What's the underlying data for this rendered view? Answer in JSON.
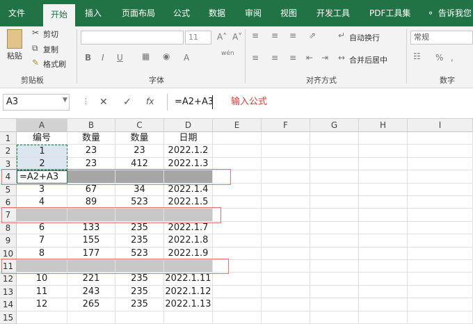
{
  "tabs": [
    "文件",
    "开始",
    "插入",
    "页面布局",
    "公式",
    "数据",
    "审阅",
    "视图",
    "开发工具",
    "PDF工具集",
    "告诉我您"
  ],
  "ribbon": {
    "paste": "粘贴",
    "cut": "剪切",
    "copy": "复制",
    "format_painter": "格式刷",
    "clipboard": "剪贴板",
    "font_size": "11",
    "font_group": "字体",
    "wrap": "自动换行",
    "merge": "合并后居中",
    "align_group": "对齐方式",
    "number_format": "常规",
    "number_group": "数字",
    "bold": "B",
    "italic": "I",
    "underline": "U",
    "font_a": "A",
    "wen": "wén"
  },
  "formula_bar": {
    "name_box": "A3",
    "formula": "=A2+A3",
    "annotation": "输入公式",
    "cancel": "✕",
    "enter": "✓",
    "fx": "fx"
  },
  "columns": [
    "A",
    "B",
    "C",
    "D",
    "E",
    "F",
    "G",
    "H",
    "I"
  ],
  "rows": [
    {
      "n": "1",
      "cells": [
        "编号",
        "数量",
        "数量",
        "日期"
      ]
    },
    {
      "n": "2",
      "cells": [
        "1",
        "23",
        "23",
        "2022.1.2"
      ]
    },
    {
      "n": "3",
      "cells": [
        "2",
        "23",
        "412",
        "2022.1.3"
      ]
    },
    {
      "n": "4",
      "cells": [
        "=A2+A3",
        "",
        "",
        ""
      ]
    },
    {
      "n": "5",
      "cells": [
        "3",
        "67",
        "34",
        "2022.1.4"
      ]
    },
    {
      "n": "6",
      "cells": [
        "4",
        "89",
        "523",
        "2022.1.5"
      ]
    },
    {
      "n": "7",
      "cells": [
        "",
        "",
        "",
        ""
      ]
    },
    {
      "n": "8",
      "cells": [
        "6",
        "133",
        "235",
        "2022.1.7"
      ]
    },
    {
      "n": "9",
      "cells": [
        "7",
        "155",
        "235",
        "2022.1.8"
      ]
    },
    {
      "n": "10",
      "cells": [
        "8",
        "177",
        "523",
        "2022.1.9"
      ]
    },
    {
      "n": "11",
      "cells": [
        "",
        "",
        "",
        ""
      ]
    },
    {
      "n": "12",
      "cells": [
        "10",
        "221",
        "235",
        "2022.1.11"
      ]
    },
    {
      "n": "13",
      "cells": [
        "11",
        "243",
        "235",
        "2022.1.12"
      ]
    },
    {
      "n": "14",
      "cells": [
        "12",
        "265",
        "235",
        "2022.1.13"
      ]
    },
    {
      "n": "15",
      "cells": [
        "",
        "",
        "",
        ""
      ]
    }
  ]
}
